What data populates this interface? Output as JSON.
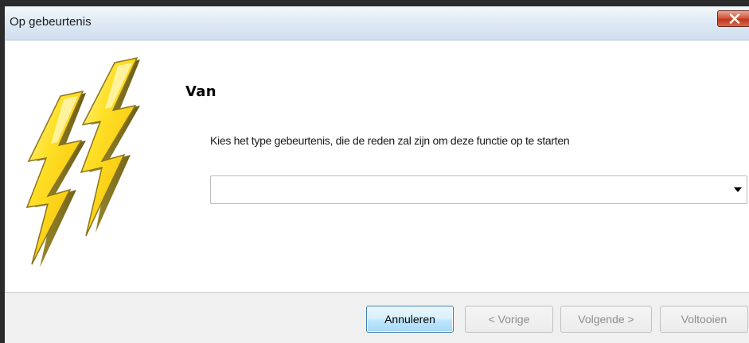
{
  "window": {
    "title": "Op gebeurtenis"
  },
  "wizard": {
    "heading": "Van",
    "instruction": "Kies het type gebeurtenis, die de reden zal zijn om deze functie op te starten",
    "event_type_select": {
      "value": ""
    }
  },
  "footer": {
    "cancel_label": "Annuleren",
    "back_label": "< Vorige",
    "next_label": "Volgende >",
    "finish_label": "Voltooien"
  },
  "icons": {
    "close": "close-icon",
    "lightning": "lightning-bolt-icon",
    "dropdown": "chevron-down-icon"
  },
  "colors": {
    "close_button": "#c1351d",
    "primary_button_border": "#3c7fb1",
    "bolt_yellow": "#ffd21f",
    "bolt_shade": "#7a6a1a"
  }
}
